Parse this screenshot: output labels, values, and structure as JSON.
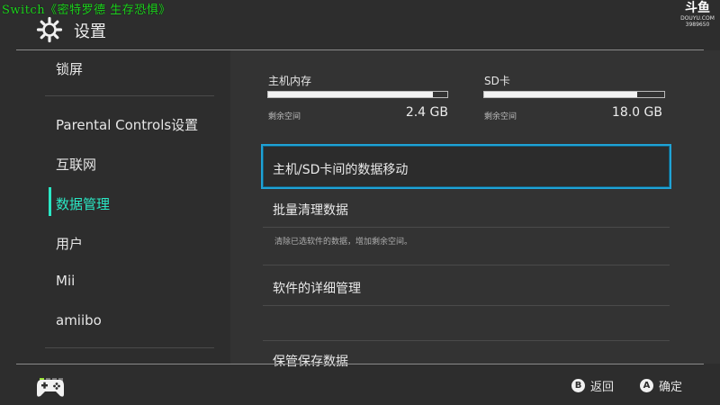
{
  "overlay": {
    "title": "Switch《密特罗德 生存恐惧》"
  },
  "watermark": {
    "main": "斗鱼",
    "sub1": "DOUYU.COM",
    "sub2": "3989650"
  },
  "header": {
    "title": "设置",
    "icon": "gear-icon"
  },
  "sidebar": {
    "items": [
      {
        "label": "锁屏",
        "active": false
      },
      {
        "label": "Parental Controls设置",
        "active": false
      },
      {
        "label": "互联网",
        "active": false
      },
      {
        "label": "数据管理",
        "active": true
      },
      {
        "label": "用户",
        "active": false
      },
      {
        "label": "Mii",
        "active": false
      },
      {
        "label": "amiibo",
        "active": false
      }
    ]
  },
  "storage": {
    "system": {
      "label": "主机内存",
      "remaining_label": "剩余空间",
      "remaining": "2.4 GB",
      "used_fraction": 0.92
    },
    "sd": {
      "label": "SD卡",
      "remaining_label": "剩余空间",
      "remaining": "18.0 GB",
      "used_fraction": 0.85
    }
  },
  "menu": {
    "items": [
      {
        "label": "主机/SD卡间的数据移动",
        "selected": true
      },
      {
        "label": "批量清理数据",
        "description": "清除已选软件的数据，增加剩余空间。"
      },
      {
        "label": "软件的详细管理"
      },
      {
        "label": "保管保存数据"
      }
    ]
  },
  "footer": {
    "back": {
      "key": "B",
      "label": "返回"
    },
    "confirm": {
      "key": "A",
      "label": "确定"
    },
    "controller_icon": "controller-icon"
  },
  "colors": {
    "accent": "#2ae8c5",
    "selection": "#1fa3d6",
    "background": "#2d2d2d",
    "panel": "#333333"
  }
}
